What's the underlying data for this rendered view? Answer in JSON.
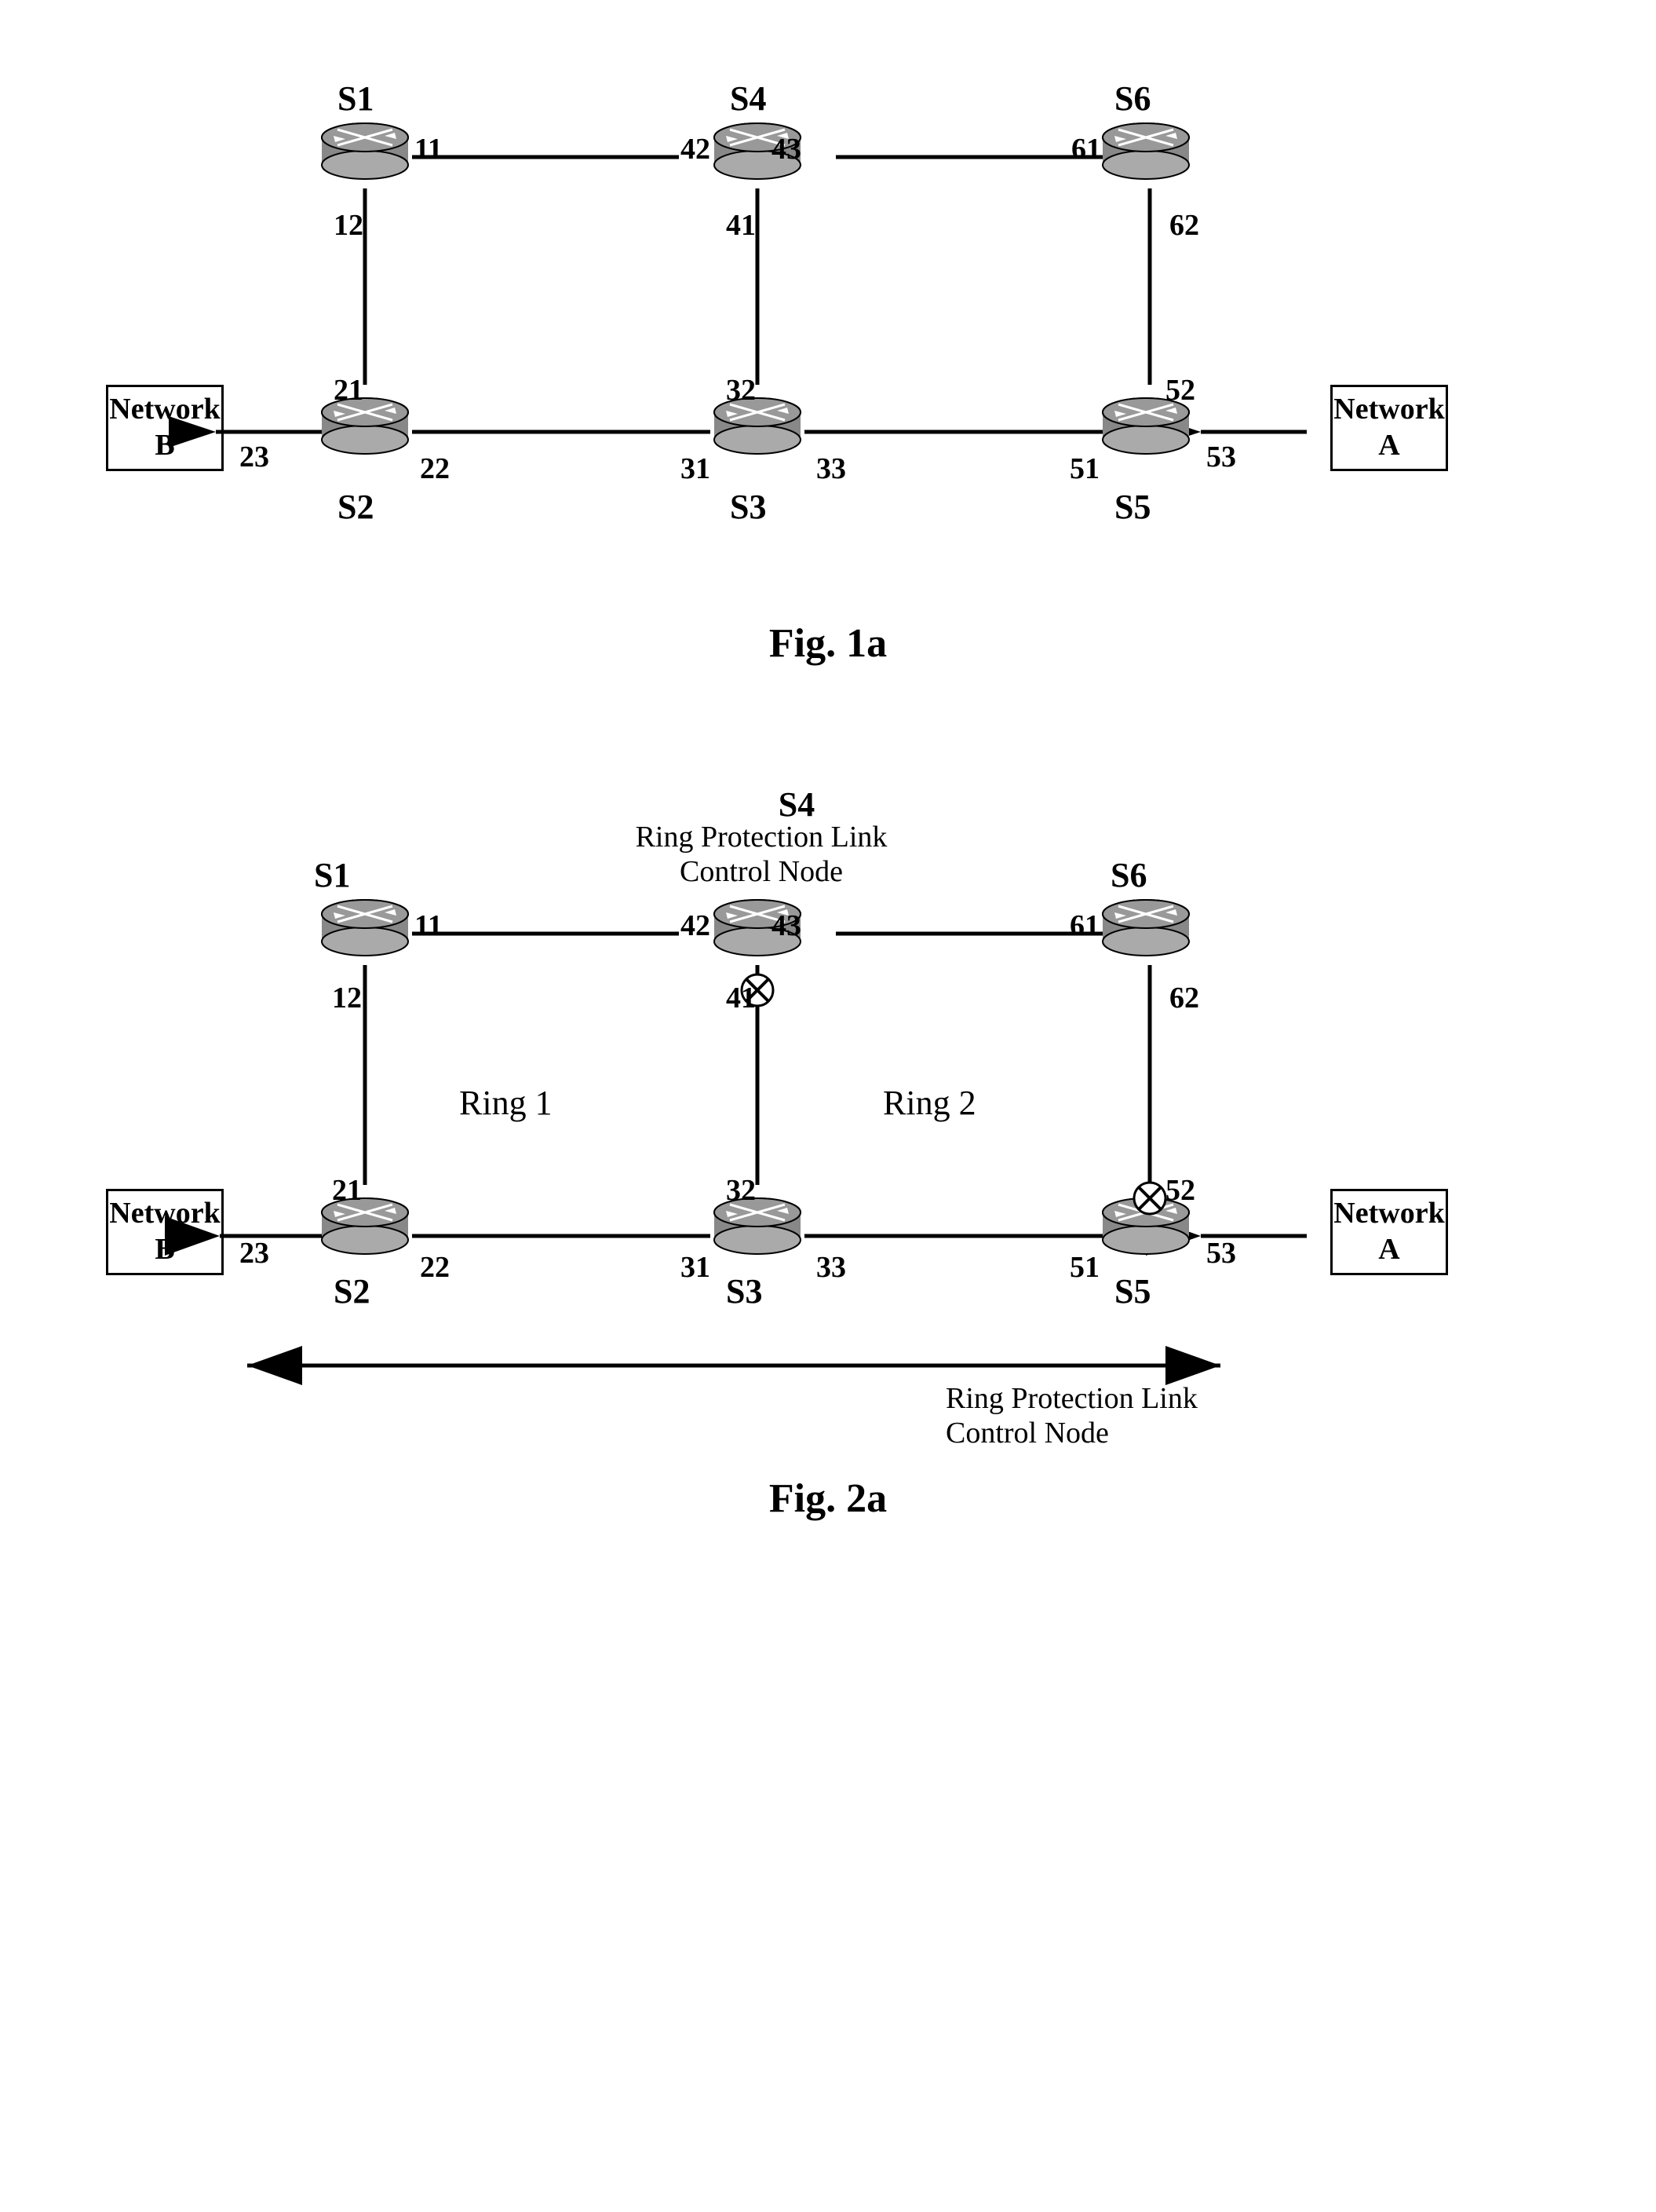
{
  "fig1a": {
    "caption": "Fig. 1a",
    "nodes": {
      "S1": {
        "label": "S1"
      },
      "S2": {
        "label": "S2"
      },
      "S3": {
        "label": "S3"
      },
      "S4": {
        "label": "S4"
      },
      "S5": {
        "label": "S5"
      },
      "S6": {
        "label": "S6"
      }
    },
    "networks": {
      "A": {
        "label": "Network\nA"
      },
      "B": {
        "label": "Network\nB"
      }
    },
    "ports": [
      "11",
      "12",
      "21",
      "22",
      "23",
      "31",
      "32",
      "33",
      "41",
      "42",
      "43",
      "51",
      "52",
      "53",
      "61",
      "62"
    ]
  },
  "fig2a": {
    "caption": "Fig. 2a",
    "ring1_label": "Ring 1",
    "ring2_label": "Ring 2",
    "rplcn_top": "Ring Protection Link\nControl Node",
    "rplcn_bottom": "Ring Protection Link\nControl Node",
    "nodes": {
      "S1": {
        "label": "S1"
      },
      "S2": {
        "label": "S2"
      },
      "S3": {
        "label": "S3"
      },
      "S4": {
        "label": "S4"
      },
      "S5": {
        "label": "S5"
      },
      "S6": {
        "label": "S6"
      }
    },
    "networks": {
      "A": {
        "label": "Network\nA"
      },
      "B": {
        "label": "Network\nB"
      }
    }
  }
}
